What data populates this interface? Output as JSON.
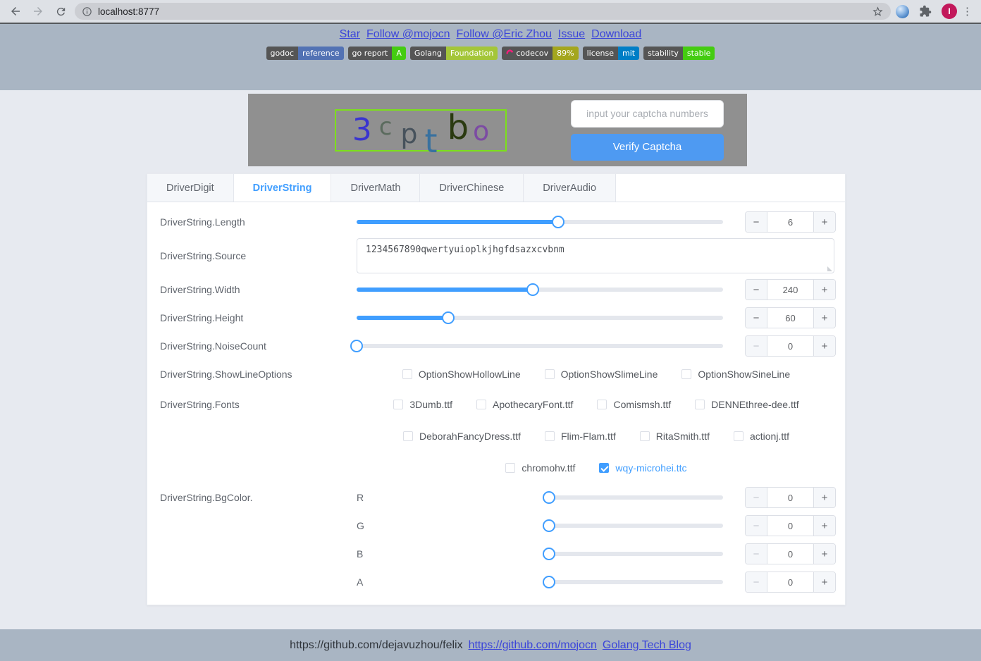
{
  "browser": {
    "url": "localhost:8777",
    "avatar_initial": "I"
  },
  "header": {
    "links": [
      {
        "label": "Star"
      },
      {
        "label": "Follow @mojocn"
      },
      {
        "label": "Follow @Eric Zhou"
      },
      {
        "label": "Issue"
      },
      {
        "label": "Download"
      }
    ],
    "badges": [
      {
        "left": "godoc",
        "right": "reference",
        "left_bg": "#555555",
        "right_bg": "#5272B4"
      },
      {
        "left": "go report",
        "right": "A",
        "left_bg": "#555555",
        "right_bg": "#44cc11"
      },
      {
        "left": "Golang",
        "right": "Foundation",
        "left_bg": "#555555",
        "right_bg": "#a4c639"
      },
      {
        "left": "codecov",
        "right": "89%",
        "left_bg": "#555555",
        "right_bg": "#a4a61d",
        "icon": "codecov-umbrella"
      },
      {
        "left": "license",
        "right": "mit",
        "left_bg": "#555555",
        "right_bg": "#007ec6"
      },
      {
        "left": "stability",
        "right": "stable",
        "left_bg": "#555555",
        "right_bg": "#44cc11"
      }
    ]
  },
  "captcha": {
    "characters": [
      {
        "ch": "3",
        "color": "#3a35cf"
      },
      {
        "ch": "c",
        "color": "#5b6b5e"
      },
      {
        "ch": "p",
        "color": "#47525c"
      },
      {
        "ch": "t",
        "color": "#38719f"
      },
      {
        "ch": "b",
        "color": "#2a3a10"
      },
      {
        "ch": "o",
        "color": "#7c4ba3"
      }
    ],
    "input_placeholder": "input your captcha numbers",
    "verify_button_label": "Verify Captcha"
  },
  "tabs": {
    "items": [
      {
        "label": "DriverDigit",
        "active": false
      },
      {
        "label": "DriverString",
        "active": true
      },
      {
        "label": "DriverMath",
        "active": false
      },
      {
        "label": "DriverChinese",
        "active": false
      },
      {
        "label": "DriverAudio",
        "active": false
      }
    ]
  },
  "form": {
    "stepper": {
      "decrease": "−",
      "increase": "+"
    },
    "length": {
      "label": "DriverString.Length",
      "value": "6",
      "percent": 55
    },
    "source": {
      "label": "DriverString.Source",
      "value": "1234567890qwertyuioplkjhgfdsazxcvbnm"
    },
    "width": {
      "label": "DriverString.Width",
      "value": "240",
      "percent": 48
    },
    "height": {
      "label": "DriverString.Height",
      "value": "60",
      "percent": 25
    },
    "noise_count": {
      "label": "DriverString.NoiseCount",
      "value": "0",
      "percent": 0
    },
    "show_line_options": {
      "label": "DriverString.ShowLineOptions",
      "options": [
        {
          "label": "OptionShowHollowLine",
          "checked": false
        },
        {
          "label": "OptionShowSlimeLine",
          "checked": false
        },
        {
          "label": "OptionShowSineLine",
          "checked": false
        }
      ]
    },
    "fonts": {
      "label": "DriverString.Fonts",
      "row1": [
        {
          "label": "3Dumb.ttf",
          "checked": false
        },
        {
          "label": "ApothecaryFont.ttf",
          "checked": false
        },
        {
          "label": "Comismsh.ttf",
          "checked": false
        },
        {
          "label": "DENNEthree-dee.ttf",
          "checked": false
        }
      ],
      "row2": [
        {
          "label": "DeborahFancyDress.ttf",
          "checked": false
        },
        {
          "label": "Flim-Flam.ttf",
          "checked": false
        },
        {
          "label": "RitaSmith.ttf",
          "checked": false
        },
        {
          "label": "actionj.ttf",
          "checked": false
        }
      ],
      "row3": [
        {
          "label": "chromohv.ttf",
          "checked": false
        },
        {
          "label": "wqy-microhei.ttc",
          "checked": true
        }
      ]
    },
    "bg_color": {
      "label": "DriverString.BgColor.",
      "channels": [
        {
          "label": "R",
          "value": "0",
          "percent": 0
        },
        {
          "label": "G",
          "value": "0",
          "percent": 0
        },
        {
          "label": "B",
          "value": "0",
          "percent": 0
        },
        {
          "label": "A",
          "value": "0",
          "percent": 0
        }
      ]
    }
  },
  "footer": {
    "text": "https://github.com/dejavuzhou/felix",
    "links": [
      {
        "label": "https://github.com/mojocn"
      },
      {
        "label": "Golang Tech Blog"
      }
    ]
  },
  "colors": {
    "accent": "#409EFF",
    "link_blue": "#3b45d9",
    "band": "#a9b5c3",
    "captcha_area_bg": "#909090",
    "captcha_border_green": "#7ce01a",
    "verify_button_blue": "#4e9af2",
    "page_bg": "#e7eaf0"
  }
}
